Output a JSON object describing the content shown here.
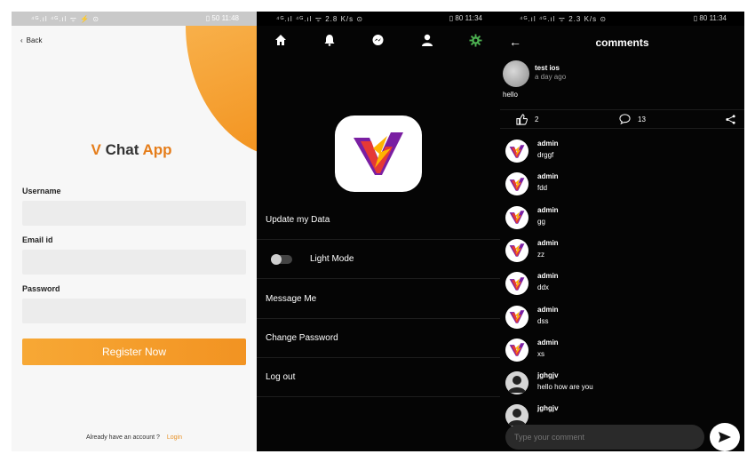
{
  "register_screen": {
    "status_bar": {
      "left": "⁴ᴳ.ıl ⁴ᴳ.ıl ᯤ ⚡ ⊙",
      "battery": "50",
      "time": "11:48"
    },
    "back_label": "Back",
    "app_title": {
      "v": "V",
      "chat": "Chat",
      "app": "App"
    },
    "fields": [
      {
        "label": "Username",
        "value": ""
      },
      {
        "label": "Email id",
        "value": ""
      },
      {
        "label": "Password",
        "value": ""
      }
    ],
    "register_button": "Register Now",
    "footer_text": "Already have an account ?",
    "login_link": "Login",
    "accent": "#f2911c"
  },
  "settings_screen": {
    "status_bar": {
      "left": "⁴ᴳ.ıl ⁴ᴳ.ıl ᯤ 2.8 K/s ⊙",
      "battery": "80",
      "time": "11:34"
    },
    "nav_icons": [
      "home-icon",
      "bell-icon",
      "messenger-icon",
      "user-icon",
      "gear-icon"
    ],
    "active_icon_color": "#4caf50",
    "menu": {
      "update": "Update my Data",
      "light_mode": "Light Mode",
      "message": "Message Me",
      "change_password": "Change Password",
      "logout": "Log out"
    }
  },
  "comments_screen": {
    "status_bar": {
      "left": "⁴ᴳ.ıl ⁴ᴳ.ıl ᯤ 2.3 K/s ⊙",
      "battery": "80",
      "time": "11:34"
    },
    "title": "comments",
    "post": {
      "author": "test ios",
      "time": "a day ago",
      "message": "hello"
    },
    "likes": "2",
    "comments_count": "13",
    "comments": [
      {
        "name": "admin",
        "text": "drggf",
        "avatar": "v-logo"
      },
      {
        "name": "admin",
        "text": "fdd",
        "avatar": "v-logo"
      },
      {
        "name": "admin",
        "text": "gg",
        "avatar": "v-logo"
      },
      {
        "name": "admin",
        "text": "zz",
        "avatar": "v-logo"
      },
      {
        "name": "admin",
        "text": "ddx",
        "avatar": "v-logo"
      },
      {
        "name": "admin",
        "text": "dss",
        "avatar": "v-logo"
      },
      {
        "name": "admin",
        "text": "xs",
        "avatar": "v-logo"
      },
      {
        "name": "jghgjv",
        "text": "hello how are you",
        "avatar": "user-silhouette"
      },
      {
        "name": "jghgjv",
        "text": "",
        "avatar": "user-silhouette"
      }
    ],
    "input_placeholder": "Type your comment"
  }
}
